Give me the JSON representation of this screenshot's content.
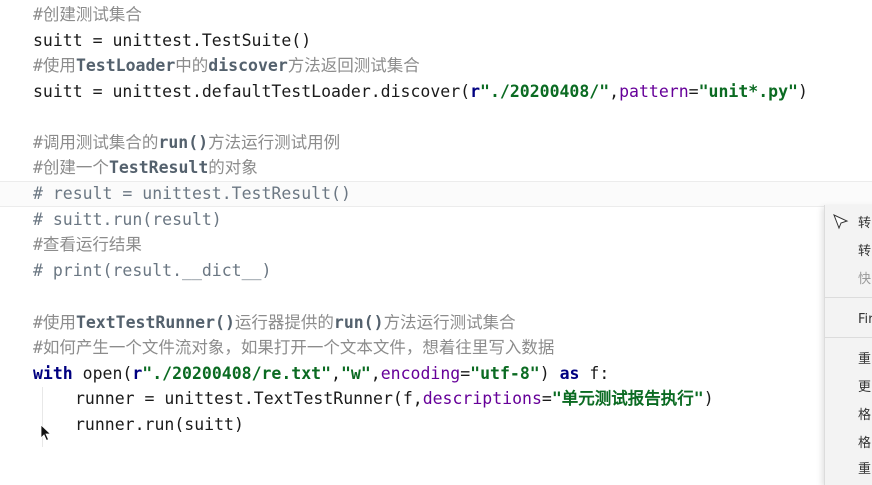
{
  "code": {
    "l1": "#创建测试集合",
    "l2": "suitt = unittest.TestSuite()",
    "l3a": "#使用",
    "l3b": "TestLoader",
    "l3c": "中的",
    "l3d": "discover",
    "l3e": "方法返回测试集合",
    "l4a": "suitt = unittest.defaultTestLoader.discover(",
    "l4b": "r",
    "l4c": "\"./20200408/\"",
    "l4d": ",",
    "l4e": "pattern",
    "l4f": "=",
    "l4g": "\"unit*.py\"",
    "l4h": ")",
    "l6a": "#调用测试集合的",
    "l6b": "run()",
    "l6c": "方法运行测试用例",
    "l7a": "#创建一个",
    "l7b": "TestResult",
    "l7c": "的对象",
    "l8": "# result = unittest.TestResult()",
    "l9": "# suitt.run(result)",
    "l10": "#查看运行结果",
    "l11": "# print(result.__dict__)",
    "l13a": "#使用",
    "l13b": "TextTestRunner()",
    "l13c": "运行器提供的",
    "l13d": "run()",
    "l13e": "方法运行测试集合",
    "l14": "#如何产生一个文件流对象，如果打开一个文本文件，想着往里写入数据",
    "l15a": "with",
    "l15b": " open(",
    "l15c": "r",
    "l15d": "\"./20200408/re.txt\"",
    "l15e": ",",
    "l15f": "\"w\"",
    "l15g": ",",
    "l15h": "encoding",
    "l15i": "=",
    "l15j": "\"utf-8\"",
    "l15k": ") ",
    "l15l": "as",
    "l15m": " f:",
    "l16a": "runner = unittest.TextTestRunner(f,",
    "l16b": "descriptions",
    "l16c": "=",
    "l16d": "\"单元测试报告执行\"",
    "l16e": ")",
    "l17": "runner.run(suitt)"
  },
  "context_menu": {
    "items": [
      "转",
      "转",
      "快",
      "Fir",
      "重",
      "更",
      "格",
      "格",
      "重"
    ]
  },
  "icons": [
    "cursor-icon",
    "mouse-pointer-icon"
  ]
}
